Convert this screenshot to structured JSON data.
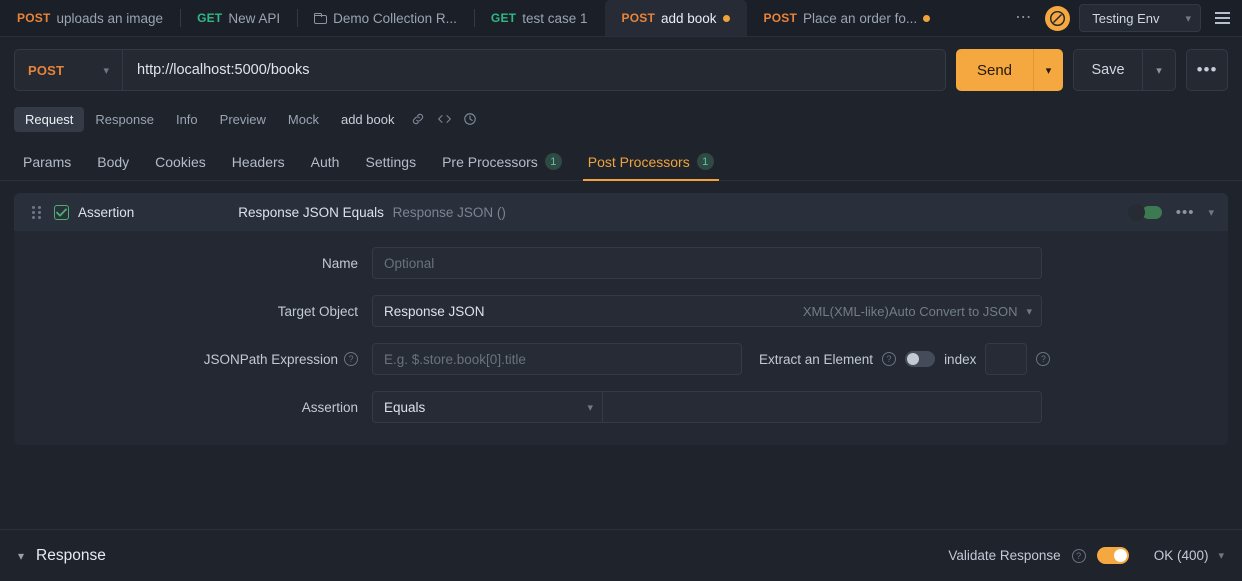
{
  "tabstrip": {
    "tabs": [
      {
        "method": "POST",
        "method_class": "m-post",
        "label": "uploads an image",
        "dirty": false,
        "folder": false,
        "active": false
      },
      {
        "method": "GET",
        "method_class": "m-get",
        "label": "New API",
        "dirty": false,
        "folder": false,
        "active": false
      },
      {
        "method": "",
        "method_class": "",
        "label": "Demo Collection R...",
        "dirty": false,
        "folder": true,
        "active": false
      },
      {
        "method": "GET",
        "method_class": "m-get",
        "label": "test case 1",
        "dirty": false,
        "folder": false,
        "active": false
      },
      {
        "method": "POST",
        "method_class": "m-post",
        "label": "add book",
        "dirty": true,
        "folder": false,
        "active": true
      },
      {
        "method": "POST",
        "method_class": "m-post",
        "label": "Place an order fo...",
        "dirty": true,
        "folder": false,
        "active": false
      }
    ],
    "overflow_label": "⋯",
    "env_icon": "slash-circle-icon",
    "environment": "Testing Env",
    "menu_icon": "hamburger-menu-icon"
  },
  "urlbar": {
    "method": "POST",
    "url": "http://localhost:5000/books",
    "send_label": "Send",
    "save_label": "Save",
    "more_label": "•••"
  },
  "subtabs": {
    "items": [
      {
        "label": "Request",
        "active": true
      },
      {
        "label": "Response",
        "active": false
      },
      {
        "label": "Info",
        "active": false
      },
      {
        "label": "Preview",
        "active": false
      },
      {
        "label": "Mock",
        "active": false
      },
      {
        "label": "add book",
        "active": false,
        "plain": true
      }
    ],
    "icons": [
      "link-icon",
      "code-icon",
      "history-icon"
    ]
  },
  "maintabs": [
    {
      "label": "Params",
      "badge": "",
      "active": false
    },
    {
      "label": "Body",
      "badge": "",
      "active": false
    },
    {
      "label": "Cookies",
      "badge": "",
      "active": false
    },
    {
      "label": "Headers",
      "badge": "",
      "active": false
    },
    {
      "label": "Auth",
      "badge": "",
      "active": false
    },
    {
      "label": "Settings",
      "badge": "",
      "active": false
    },
    {
      "label": "Pre Processors",
      "badge": "1",
      "active": false
    },
    {
      "label": "Post Processors",
      "badge": "1",
      "active": true
    }
  ],
  "assertion_card": {
    "checkbox_checked": true,
    "title": "Assertion",
    "summary": "Response JSON Equals",
    "summary_muted": "Response JSON ()",
    "enabled_toggle": true,
    "more_label": "•••",
    "fields": {
      "name_label": "Name",
      "name_value": "",
      "name_placeholder": "Optional",
      "target_label": "Target Object",
      "target_value": "Response JSON",
      "target_hint": "XML(XML-like)Auto Convert to JSON",
      "jsonpath_label": "JSONPath Expression",
      "jsonpath_value": "",
      "jsonpath_placeholder": "E.g. $.store.book[0].title",
      "extract_label": "Extract an Element",
      "extract_enabled": false,
      "index_label": "index",
      "index_value": "",
      "assertion_label": "Assertion",
      "assertion_operator": "Equals",
      "assertion_value": ""
    }
  },
  "bottombar": {
    "response_label": "Response",
    "validate_label": "Validate Response",
    "validate_enabled": true,
    "status_label": "OK (400)"
  },
  "colors": {
    "accent": "#f5a83f",
    "post": "#e8833a",
    "get": "#2fb886",
    "success": "#4caf6d",
    "page_bg": "#1f232c",
    "card_bg": "#232832"
  }
}
